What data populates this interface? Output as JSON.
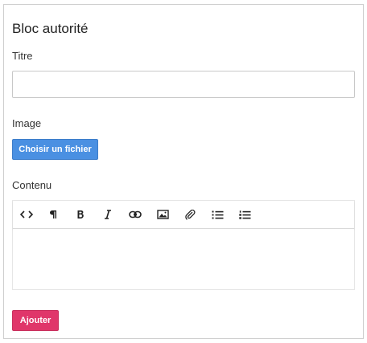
{
  "form": {
    "title": "Bloc autorité",
    "titre_label": "Titre",
    "titre_value": "",
    "image_label": "Image",
    "file_button_label": "Choisir un fichier",
    "contenu_label": "Contenu",
    "submit_label": "Ajouter"
  },
  "toolbar": {
    "code": "<>",
    "paragraph": "¶",
    "bold": "B",
    "italic": "I",
    "link": "link-icon",
    "image": "image-icon",
    "attachment": "paperclip-icon",
    "bullet_list": "bullet-list-icon",
    "numbered_list": "numbered-list-icon"
  },
  "colors": {
    "primary_button": "#4a90e2",
    "submit_button": "#e0366a",
    "border": "#cfcfcf"
  }
}
